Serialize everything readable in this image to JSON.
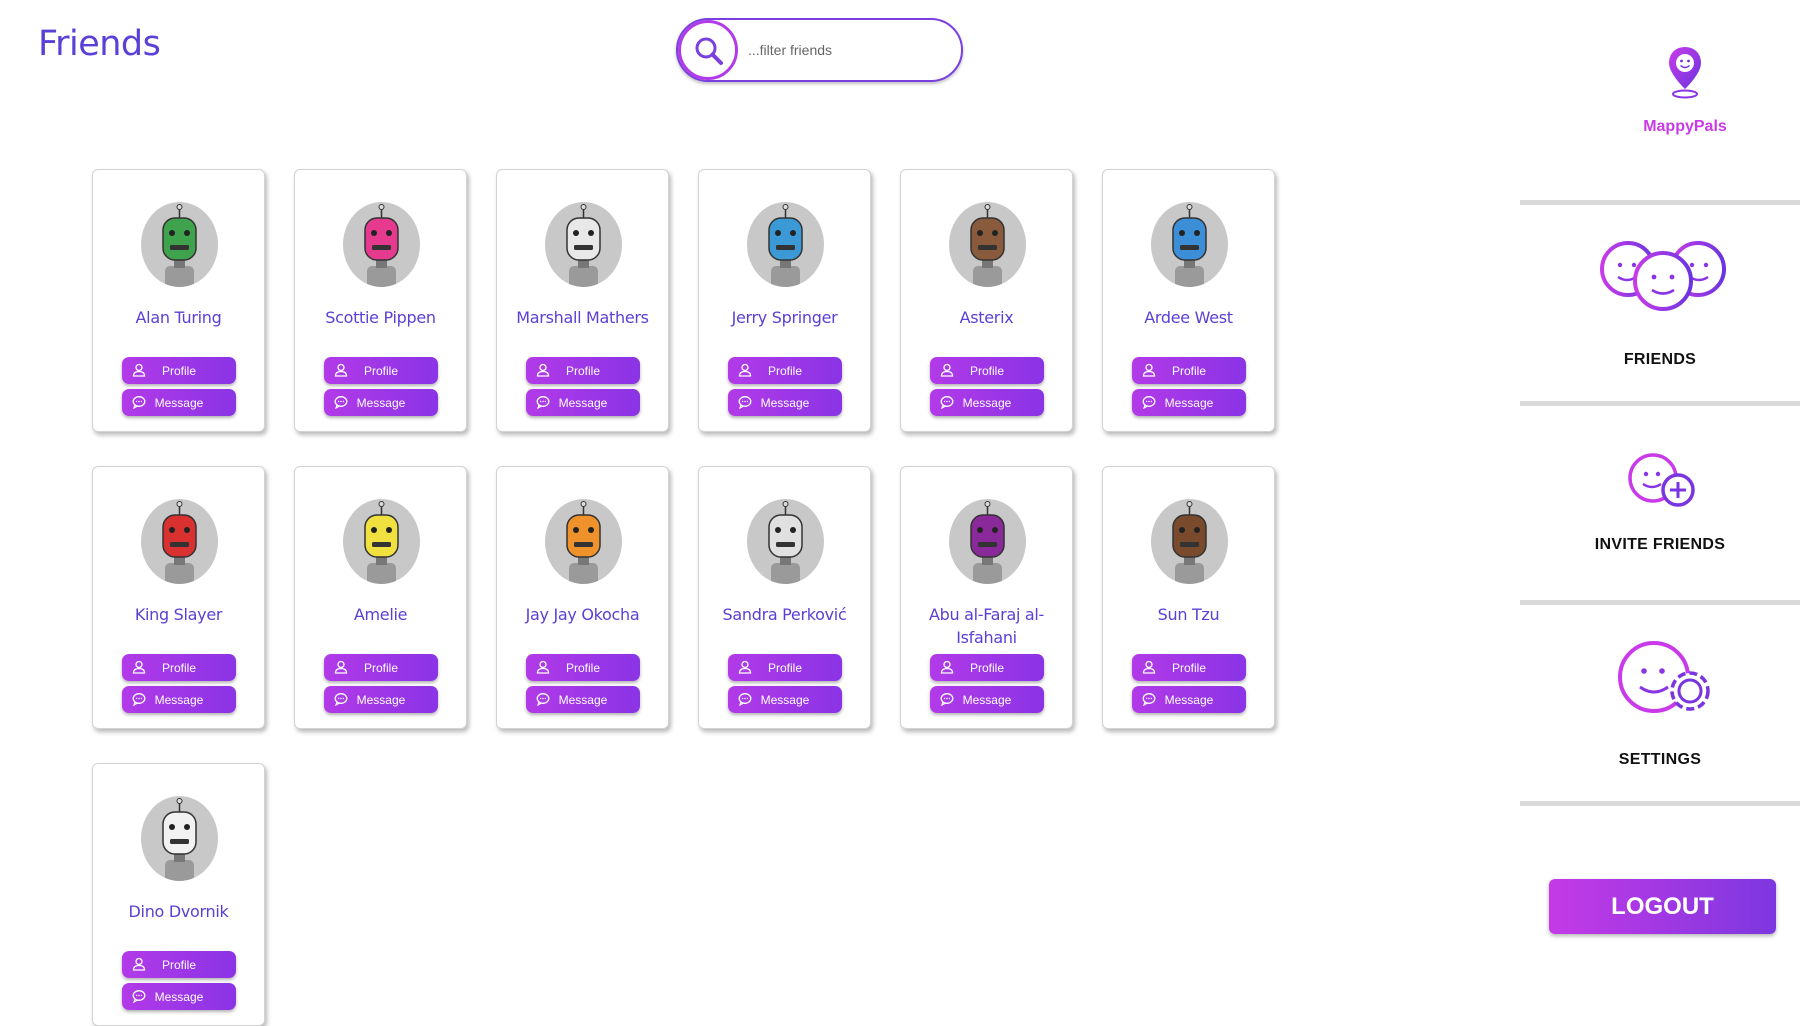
{
  "header": {
    "title": "Friends"
  },
  "search": {
    "placeholder": "...filter friends",
    "value": ""
  },
  "buttons": {
    "profile": "Profile",
    "message": "Message"
  },
  "friends": [
    {
      "name": "Alan Turing",
      "color": "#3fa34d"
    },
    {
      "name": "Scottie Pippen",
      "color": "#e63a8e"
    },
    {
      "name": "Marshall Mathers",
      "color": "#e8e8e8"
    },
    {
      "name": "Jerry Springer",
      "color": "#3b9ad6"
    },
    {
      "name": "Asterix",
      "color": "#8a5a3c"
    },
    {
      "name": "Ardee West",
      "color": "#3c8fd6"
    },
    {
      "name": "King Slayer",
      "color": "#d93030"
    },
    {
      "name": "Amelie",
      "color": "#f0e040"
    },
    {
      "name": "Jay Jay Okocha",
      "color": "#f0922c"
    },
    {
      "name": "Sandra Perković",
      "color": "#e0e0e0"
    },
    {
      "name": "Abu al-Faraj al-Isfahani",
      "color": "#8a2a9a"
    },
    {
      "name": "Sun Tzu",
      "color": "#7a4a2c"
    },
    {
      "name": "Dino Dvornik",
      "color": "#f2f2f2"
    }
  ],
  "sidebar": {
    "brand": "MappyPals",
    "nav": [
      {
        "label": "FRIENDS",
        "icon": "friends-icon"
      },
      {
        "label": "INVITE FRIENDS",
        "icon": "invite-friends-icon"
      },
      {
        "label": "SETTINGS",
        "icon": "settings-icon"
      }
    ],
    "logout": "LOGOUT"
  },
  "colors": {
    "accent": "#8a34e6",
    "accent_pink": "#c93be8",
    "title": "#5b3fd6"
  }
}
